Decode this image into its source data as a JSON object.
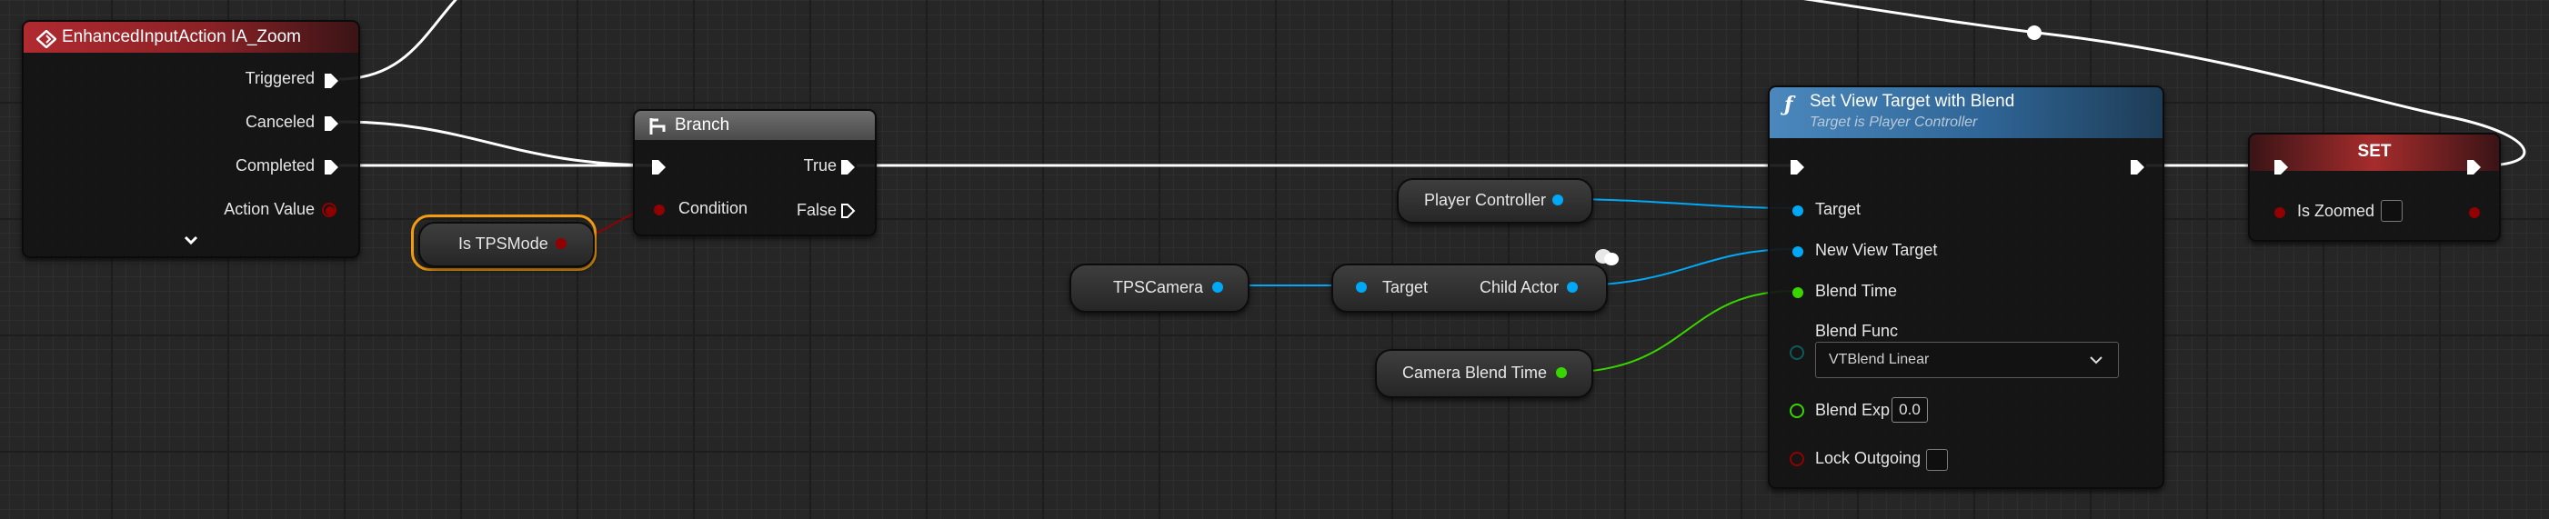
{
  "colors": {
    "exec": "#ffffff",
    "bool": "#920101",
    "object": "#00a8f5",
    "float": "#38d500",
    "event_header": "#a6262c",
    "func_header": "#3a6e9f",
    "set_header": "#9c2a2a",
    "branch_header": "#5a5a5a",
    "selection": "#f39c12"
  },
  "nodes": {
    "input_action": {
      "title": "EnhancedInputAction IA_Zoom",
      "icon": "input-action-icon",
      "pins": {
        "triggered": "Triggered",
        "canceled": "Canceled",
        "completed": "Completed",
        "action_value": "Action Value"
      },
      "expand_icon": "chevron-down-icon"
    },
    "is_tps_mode": {
      "label": "Is TPSMode"
    },
    "branch": {
      "title": "Branch",
      "icon": "branch-icon",
      "pins": {
        "condition": "Condition",
        "true": "True",
        "false": "False"
      }
    },
    "player_controller": {
      "label": "Player Controller"
    },
    "tps_camera": {
      "label": "TPSCamera"
    },
    "child_actor": {
      "target": "Target",
      "output": "Child Actor"
    },
    "camera_blend_time": {
      "label": "Camera Blend Time"
    },
    "set_view_target": {
      "title": "Set View Target with Blend",
      "subtitle": "Target is Player Controller",
      "icon": "function-icon",
      "pins": {
        "target": "Target",
        "new_view_target": "New View Target",
        "blend_time": "Blend Time",
        "blend_func": "Blend Func",
        "blend_exp": "Blend Exp",
        "lock_outgoing": "Lock Outgoing"
      },
      "blend_func_value": "VTBlend Linear",
      "blend_exp_value": "0.0",
      "lock_outgoing_checked": false
    },
    "set_zoomed": {
      "title": "SET",
      "pin": "Is Zoomed",
      "checked": false
    }
  }
}
